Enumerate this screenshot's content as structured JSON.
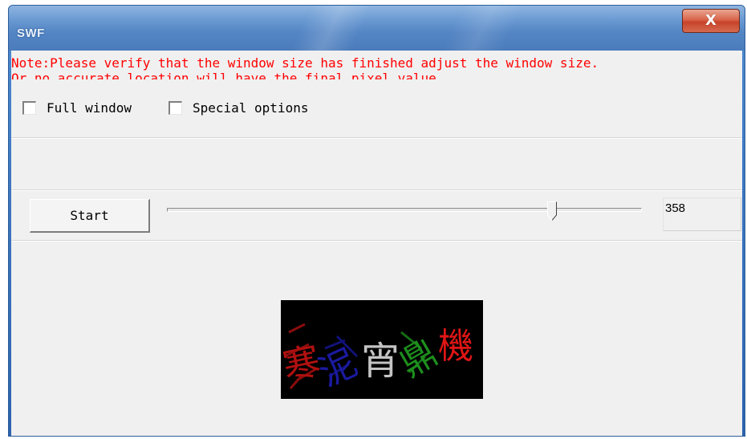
{
  "window": {
    "title": "SWF",
    "close_label": "X"
  },
  "note": {
    "line1": "Note:Please verify that the window size has finished adjust the window size.",
    "line2": "Or no accurate location will have the final pixel value."
  },
  "options": {
    "full_window": {
      "label": "Full window",
      "checked": false
    },
    "special_options": {
      "label": "Special options",
      "checked": false
    }
  },
  "controls": {
    "start_label": "Start",
    "slider_value": 358,
    "slider_fraction": 0.81,
    "value_display": "358"
  },
  "captcha": {
    "characters": [
      "寒",
      "泥",
      "宵",
      "鼎",
      "機"
    ],
    "colors": [
      "#b01010",
      "#1a1a9e",
      "#d9d9d9",
      "#1d8f1d",
      "#e01515"
    ],
    "background": "#000000"
  },
  "colors": {
    "note_text": "#ff0000",
    "client_bg": "#f0f0f0",
    "title_bar": "#5485c4",
    "close_button": "#d05a3f"
  }
}
